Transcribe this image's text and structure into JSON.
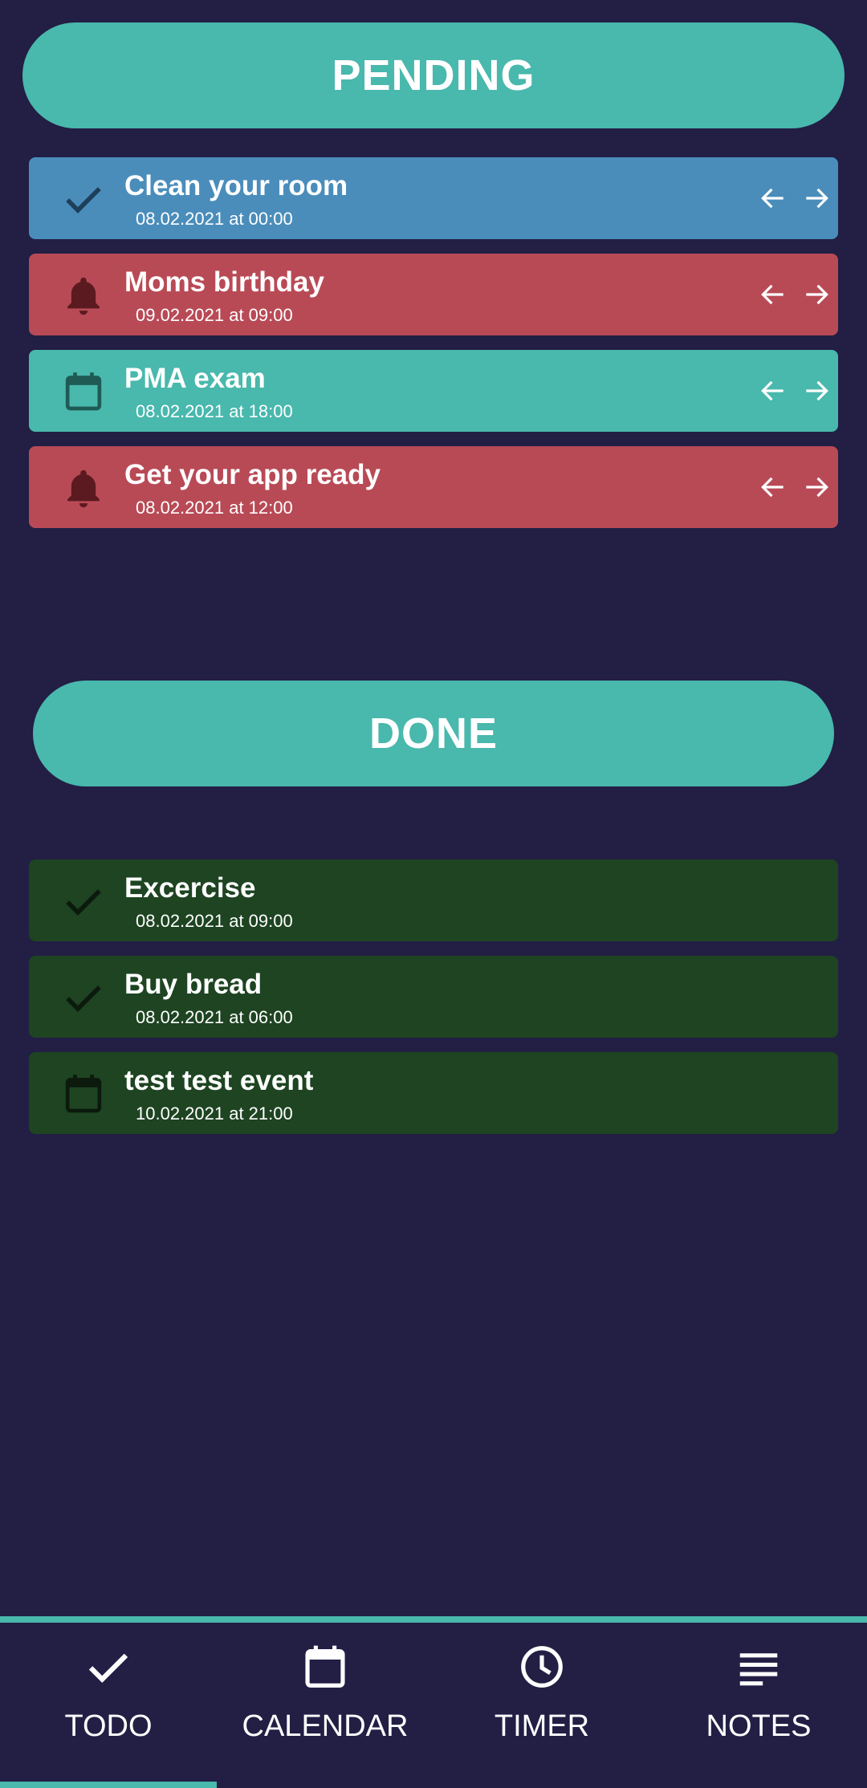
{
  "pending": {
    "header": "PENDING",
    "tasks": [
      {
        "title": "Clean your room",
        "date": "08.02.2021 at 00:00",
        "icon": "check-icon",
        "color": "#4a8dbb"
      },
      {
        "title": "Moms birthday",
        "date": "09.02.2021 at 09:00",
        "icon": "bell-icon",
        "color": "#b84a56"
      },
      {
        "title": "PMA exam",
        "date": "08.02.2021 at 18:00",
        "icon": "calendar-icon",
        "color": "#49b8ad"
      },
      {
        "title": "Get your app ready",
        "date": "08.02.2021 at 12:00",
        "icon": "bell-icon",
        "color": "#b84a56"
      }
    ]
  },
  "done": {
    "header": "DONE",
    "tasks": [
      {
        "title": "Excercise",
        "date": "08.02.2021 at 09:00",
        "icon": "check-icon",
        "color": "#1e4422"
      },
      {
        "title": "Buy bread",
        "date": "08.02.2021 at 06:00",
        "icon": "check-icon",
        "color": "#1e4422"
      },
      {
        "title": "test test event",
        "date": "10.02.2021 at 21:00",
        "icon": "calendar-icon",
        "color": "#1e4422"
      }
    ]
  },
  "nav": {
    "items": [
      {
        "label": "TODO",
        "icon": "check-icon",
        "selected": true
      },
      {
        "label": "CALENDAR",
        "icon": "calendar-icon",
        "selected": false
      },
      {
        "label": "TIMER",
        "icon": "clock-icon",
        "selected": false
      },
      {
        "label": "NOTES",
        "icon": "notes-icon",
        "selected": false
      }
    ]
  },
  "colors": {
    "background": "#221e44",
    "accent": "#49b8ad",
    "blue_task": "#4a8dbb",
    "red_task": "#b84a56",
    "done_task": "#1e4422"
  }
}
